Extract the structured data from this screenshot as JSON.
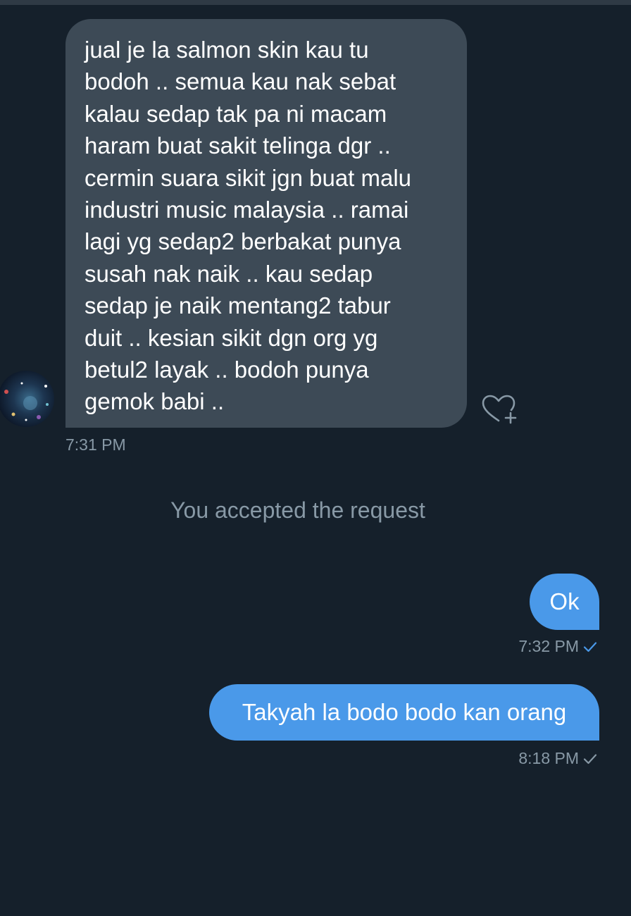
{
  "colors": {
    "background": "#15202b",
    "incoming_bubble": "#3d4a56",
    "outgoing_bubble": "#4a99e9",
    "muted_text": "#8899a6",
    "read_check": "#4a99e9",
    "sent_check": "#8899a6"
  },
  "messages": [
    {
      "direction": "incoming",
      "text": "jual je la salmon skin kau tu\nbodoh ..  semua kau nak sebat\nkalau sedap tak pa ni macam\nharam buat sakit telinga dgr ..\ncermin suara sikit jgn buat malu\nindustri music malaysia .. ramai\nlagi yg sedap2 berbakat punya\nsusah nak naik .. kau sedap\nsedap je naik mentang2 tabur\nduit .. kesian sikit dgn org yg\nbetul2 layak .. bodoh punya\ngemok babi ..",
      "time": "7:31 PM",
      "avatar_icon": "galaxy-avatar",
      "action_icon": "heart-plus-icon"
    },
    {
      "direction": "system",
      "text": "You accepted the request"
    },
    {
      "direction": "outgoing",
      "text": "Ok",
      "time": "7:32 PM",
      "status_icon": "check-icon",
      "status": "read"
    },
    {
      "direction": "outgoing",
      "text": "Takyah la bodo bodo kan orang",
      "time": "8:18 PM",
      "status_icon": "check-icon",
      "status": "sent"
    }
  ]
}
